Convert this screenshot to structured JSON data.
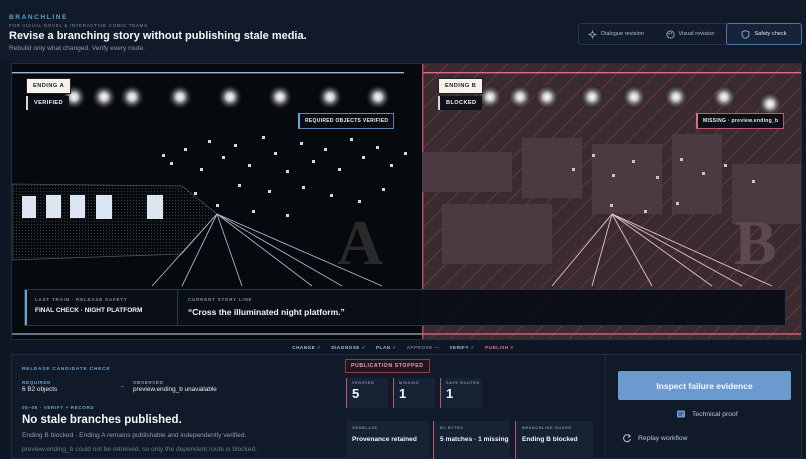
{
  "header": {
    "brand": "BRANCHLINE",
    "tagline": "FOR VISUAL NOVEL & INTERACTIVE COMIC TEAMS",
    "headline": "Revise a branching story without publishing stale media.",
    "subline": "Rebuild only what changed. Verify every route.",
    "mode_tabs": [
      {
        "label": "Dialogue revision",
        "icon": "dialogue-revision-icon"
      },
      {
        "label": "Visual revision",
        "icon": "palette-icon"
      },
      {
        "label": "Safety check",
        "icon": "shield-icon",
        "active": true
      }
    ]
  },
  "stage": {
    "ending_a": {
      "badge": "ENDING A",
      "status": "VERIFIED",
      "tag": "REQUIRED OBJECTS VERIFIED",
      "watermark": "A"
    },
    "ending_b": {
      "badge": "ENDING B",
      "status": "BLOCKED",
      "tag": "MISSING · preview.ending_b",
      "watermark": "B"
    },
    "story": {
      "left_label": "LAST TRAIN · RELEASE SAFETY",
      "left_value": "FINAL CHECK · NIGHT PLATFORM",
      "right_label": "CURRENT STORY LINE",
      "right_value": "“Cross the illuminated night platform.”"
    }
  },
  "pipeline": [
    {
      "label": "CHANGE ✓",
      "state": "done"
    },
    {
      "label": "DIAGNOSE ✓",
      "state": "done"
    },
    {
      "label": "PLAN ✓",
      "state": "done"
    },
    {
      "label": "APPROVE —",
      "state": "pending"
    },
    {
      "label": "VERIFY ✓",
      "state": "done"
    },
    {
      "label": "PUBLISH ×",
      "state": "fail"
    }
  ],
  "release": {
    "title": "RELEASE CANDIDATE CHECK",
    "required_label": "REQUIRED",
    "required_value": "6 B2 objects",
    "arrow": "→",
    "observed_label": "OBSERVED",
    "observed_value": "preview.ending_b unavailable",
    "step_label": "05–06 · VERIFY + RECORD",
    "result_title": "No stale branches published.",
    "result_p1": "Ending B blocked · Ending A remains publishable and independently verified.",
    "result_p2": "preview.ending_b could not be retrieved, so only the dependent route is blocked."
  },
  "publication": {
    "status": "PUBLICATION STOPPED",
    "metrics": [
      {
        "label": "VERIFIED",
        "value": "5"
      },
      {
        "label": "MISSING",
        "value": "1"
      },
      {
        "label": "SAFE ROUTES",
        "value": "1"
      }
    ],
    "stats": [
      {
        "label": "GENBLAZE",
        "value": "Provenance retained"
      },
      {
        "label": "B2 BYTES",
        "value": "5 matches · 1 missing"
      },
      {
        "label": "BRANCHLINE GUARD",
        "value": "Ending B blocked"
      }
    ]
  },
  "actions": {
    "primary": "Inspect failure evidence",
    "technical": "Technical proof",
    "replay": "Replay workflow"
  },
  "colors": {
    "accent": "#6b9ad1",
    "danger": "#e06b83",
    "brand": "#59a3ce"
  }
}
